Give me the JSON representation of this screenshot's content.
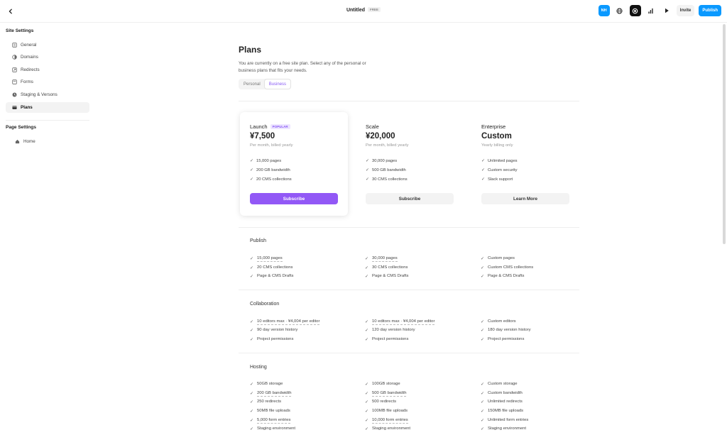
{
  "topbar": {
    "back_icon": "chevron-left-icon",
    "site_title": "Untitled",
    "plan_badge": "FREE",
    "avatar_initials": "NH",
    "invite_label": "Invite",
    "publish_label": "Publish",
    "accent_color": "#0a99ff"
  },
  "sidebar": {
    "site_settings_heading": "Site Settings",
    "site_items": [
      {
        "label": "General",
        "icon": "general-icon"
      },
      {
        "label": "Domains",
        "icon": "domains-icon"
      },
      {
        "label": "Redirects",
        "icon": "redirects-icon"
      },
      {
        "label": "Forms",
        "icon": "forms-icon"
      },
      {
        "label": "Staging & Versons",
        "icon": "staging-icon"
      },
      {
        "label": "Plans",
        "icon": "plans-icon",
        "active": true
      }
    ],
    "page_settings_heading": "Page Settings",
    "page_items": [
      {
        "label": "Home",
        "icon": "home-icon"
      }
    ]
  },
  "main": {
    "title": "Plans",
    "description": "You are currently on a free site plan. Select any of the personal or business plans that fits your needs.",
    "tabs": [
      {
        "label": "Personal",
        "active": false
      },
      {
        "label": "Business",
        "active": true
      }
    ],
    "plans": [
      {
        "name": "Launch",
        "badge": "POPULAR",
        "price": "¥7,500",
        "note": "Per month, billed yearly",
        "features": [
          "15,000 pages",
          "200 GB bandwidth",
          "20 CMS collections"
        ],
        "button": "Subscribe"
      },
      {
        "name": "Scale",
        "price": "¥20,000",
        "note": "Per month, billed yearly",
        "features": [
          "30,000 pages",
          "500 GB bandwidth",
          "30 CMS collections"
        ],
        "button": "Subscribe"
      },
      {
        "name": "Enterprise",
        "price": "Custom",
        "note": "Yearly billing only",
        "features": [
          "Unlimited pages",
          "Custom security",
          "Slack support"
        ],
        "button": "Learn More"
      }
    ],
    "sections": [
      {
        "title": "Publish",
        "columns": [
          [
            "15,000 pages",
            "20 CMS collections",
            "Page & CMS Drafts"
          ],
          [
            "30,000 pages",
            "30 CMS collections",
            "Page & CMS Drafts"
          ],
          [
            "Custom pages",
            "Custom CMS collections",
            "Page & CMS Drafts"
          ]
        ]
      },
      {
        "title": "Collaboration",
        "columns": [
          [
            "10 editors max · ¥4,004 per editor",
            "90 day version history",
            "Project permissions"
          ],
          [
            "10 editors max · ¥4,004 per editor",
            "120 day version history",
            "Project permissions"
          ],
          [
            "Custom editors",
            "180 day version history",
            "Project permissions"
          ]
        ]
      },
      {
        "title": "Hosting",
        "columns": [
          [
            "50GB storage",
            "200 GB bandwidth",
            "250 redirects",
            "50MB file uploads",
            "5,000 form entries",
            "Staging environment"
          ],
          [
            "100GB storage",
            "500 GB bandwidth",
            "500 redirects",
            "100MB file uploads",
            "10,000 form entries",
            "Staging environment"
          ],
          [
            "Custom storage",
            "Custom bandwidth",
            "Unlimited redirects",
            "150MB file uploads",
            "Unlimited form entries",
            "Staging environment"
          ]
        ]
      }
    ],
    "primary_button_color": "#9258f6",
    "badge_color": "#8a5cf6"
  }
}
